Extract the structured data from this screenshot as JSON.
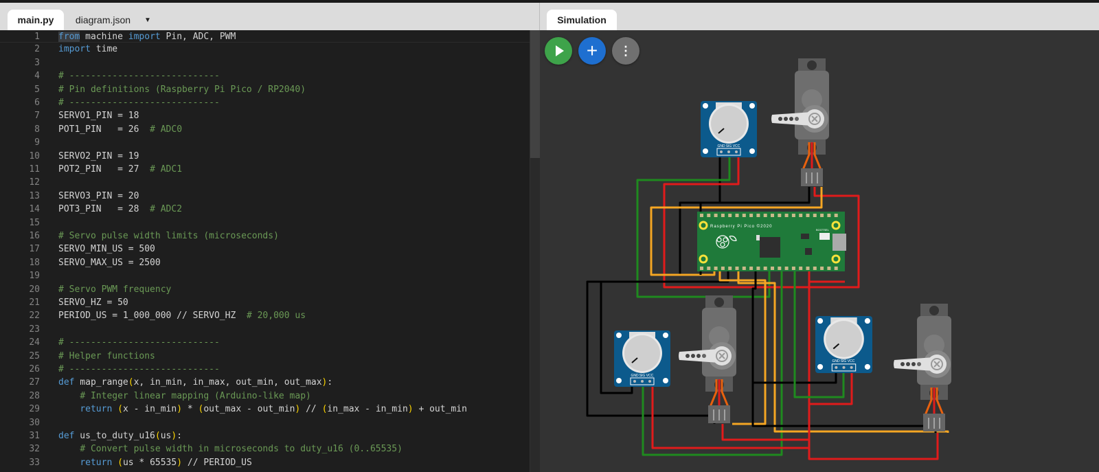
{
  "editor": {
    "tabs": [
      {
        "label": "main.py",
        "active": true
      },
      {
        "label": "diagram.json",
        "active": false
      }
    ],
    "tab_menu_icon": "caret-down-icon",
    "lines": [
      [
        [
          "k",
          "from"
        ],
        [
          "t",
          " machine "
        ],
        [
          "k",
          "import"
        ],
        [
          "t",
          " Pin, ADC, PWM"
        ]
      ],
      [
        [
          "k",
          "import"
        ],
        [
          "t",
          " time"
        ]
      ],
      [],
      [
        [
          "c",
          "# ----------------------------"
        ]
      ],
      [
        [
          "c",
          "# Pin definitions (Raspberry Pi Pico / RP2040)"
        ]
      ],
      [
        [
          "c",
          "# ----------------------------"
        ]
      ],
      [
        [
          "t",
          "SERVO1_PIN = 18"
        ]
      ],
      [
        [
          "t",
          "POT1_PIN   = 26  "
        ],
        [
          "c",
          "# ADC0"
        ]
      ],
      [],
      [
        [
          "t",
          "SERVO2_PIN = 19"
        ]
      ],
      [
        [
          "t",
          "POT2_PIN   = 27  "
        ],
        [
          "c",
          "# ADC1"
        ]
      ],
      [],
      [
        [
          "t",
          "SERVO3_PIN = 20"
        ]
      ],
      [
        [
          "t",
          "POT3_PIN   = 28  "
        ],
        [
          "c",
          "# ADC2"
        ]
      ],
      [],
      [
        [
          "c",
          "# Servo pulse width limits (microseconds)"
        ]
      ],
      [
        [
          "t",
          "SERVO_MIN_US = 500"
        ]
      ],
      [
        [
          "t",
          "SERVO_MAX_US = 2500"
        ]
      ],
      [],
      [
        [
          "c",
          "# Servo PWM frequency"
        ]
      ],
      [
        [
          "t",
          "SERVO_HZ = 50"
        ]
      ],
      [
        [
          "t",
          "PERIOD_US = 1_000_000 // SERVO_HZ  "
        ],
        [
          "c",
          "# 20,000 us"
        ]
      ],
      [],
      [
        [
          "c",
          "# ----------------------------"
        ]
      ],
      [
        [
          "c",
          "# Helper functions"
        ]
      ],
      [
        [
          "c",
          "# ----------------------------"
        ]
      ],
      [
        [
          "k",
          "def"
        ],
        [
          "t",
          " map_range"
        ],
        [
          "p",
          "("
        ],
        [
          "t",
          "x, in_min, in_max, out_min, out_max"
        ],
        [
          "p",
          ")"
        ],
        [
          "t",
          ":"
        ]
      ],
      [
        [
          "t",
          "    "
        ],
        [
          "c",
          "# Integer linear mapping (Arduino-like map)"
        ]
      ],
      [
        [
          "t",
          "    "
        ],
        [
          "k",
          "return"
        ],
        [
          "t",
          " "
        ],
        [
          "p",
          "("
        ],
        [
          "t",
          "x - in_min"
        ],
        [
          "p",
          ")"
        ],
        [
          "t",
          " * "
        ],
        [
          "p",
          "("
        ],
        [
          "t",
          "out_max - out_min"
        ],
        [
          "p",
          ")"
        ],
        [
          "t",
          " // "
        ],
        [
          "p",
          "("
        ],
        [
          "t",
          "in_max - in_min"
        ],
        [
          "p",
          ")"
        ],
        [
          "t",
          " + out_min"
        ]
      ],
      [],
      [
        [
          "k",
          "def"
        ],
        [
          "t",
          " us_to_duty_u16"
        ],
        [
          "p",
          "("
        ],
        [
          "t",
          "us"
        ],
        [
          "p",
          ")"
        ],
        [
          "t",
          ":"
        ]
      ],
      [
        [
          "t",
          "    "
        ],
        [
          "c",
          "# Convert pulse width in microseconds to duty_u16 (0..65535)"
        ]
      ],
      [
        [
          "t",
          "    "
        ],
        [
          "k",
          "return"
        ],
        [
          "t",
          " "
        ],
        [
          "p",
          "("
        ],
        [
          "t",
          "us * 65535"
        ],
        [
          "p",
          ")"
        ],
        [
          "t",
          " // PERIOD_US"
        ]
      ]
    ]
  },
  "simulation": {
    "tab_label": "Simulation",
    "buttons": [
      {
        "name": "start-simulation-button",
        "icon": "play-icon",
        "color": "#3ea34a"
      },
      {
        "name": "add-part-button",
        "icon": "plus-icon",
        "color": "#1e6fd0"
      },
      {
        "name": "more-options-button",
        "icon": "kebab-menu-icon",
        "color": "#707070"
      }
    ],
    "board_label": "Raspberry Pi Pico ©2020",
    "bootsel_label": "BOOTSEL",
    "pot_pin_labels": [
      "GND",
      "SIG",
      "VCC"
    ],
    "wire_colors": {
      "gnd": "#000000",
      "signal": "#1f8a1f",
      "vcc": "#e01b1b",
      "pwm": "#f5a623"
    }
  }
}
